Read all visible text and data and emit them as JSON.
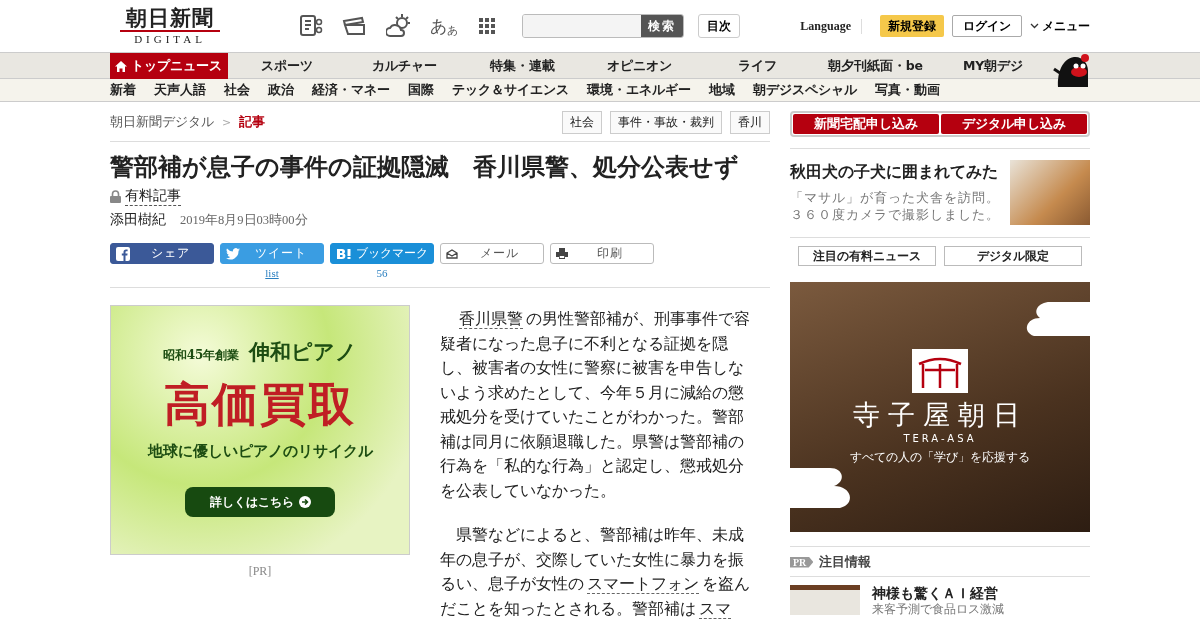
{
  "header": {
    "logo": {
      "name": "朝日新聞",
      "sub": "DIGITAL"
    },
    "tool_icons": [
      {
        "kind": "clipping"
      },
      {
        "kind": "ticket"
      },
      {
        "kind": "weather"
      },
      {
        "kind": "font",
        "large": "あ",
        "small": "あ"
      },
      {
        "kind": "grid"
      }
    ],
    "search": {
      "button": "検索"
    },
    "index_button": "目次",
    "language": "Language",
    "register": "新規登録",
    "login": "ログイン",
    "menu": "メニュー"
  },
  "nav_main": [
    {
      "label": "トップニュース",
      "selected": true
    },
    {
      "label": "スポーツ",
      "selected": false
    },
    {
      "label": "カルチャー",
      "selected": false
    },
    {
      "label": "特集・連載",
      "selected": false
    },
    {
      "label": "オピニオン",
      "selected": false
    },
    {
      "label": "ライフ",
      "selected": false
    },
    {
      "label": "朝夕刊紙面・be",
      "selected": false
    },
    {
      "label": "MY朝デジ",
      "selected": false
    }
  ],
  "nav_sub": [
    "新着",
    "天声人語",
    "社会",
    "政治",
    "経済・マネー",
    "国際",
    "テック＆サイエンス",
    "環境・エネルギー",
    "地域",
    "朝デジスペシャル",
    "写真・動画"
  ],
  "breadcrumb_separator": ">",
  "breadcrumb": [
    {
      "label": "朝日新聞デジタル",
      "current": false
    },
    {
      "label": "記事",
      "current": true
    }
  ],
  "tags": [
    "社会",
    "事件・事故・裁判",
    "香川"
  ],
  "article": {
    "title": "警部補が息子の事件の証拠隠滅　香川県警、処分公表せず",
    "paid_label": "有料記事",
    "author": "添田樹紀",
    "date": "2019年8月9日03時00分",
    "share": [
      {
        "kind": "facebook",
        "label": "シェア"
      },
      {
        "kind": "twitter",
        "label": "ツイート",
        "count": "list"
      },
      {
        "kind": "hatena",
        "label": "ブックマーク",
        "count": "56"
      },
      {
        "kind": "mail",
        "label": "メール"
      },
      {
        "kind": "print",
        "label": "印刷"
      }
    ],
    "paragraphs": [
      [
        {
          "text": "香川県警",
          "link": true
        },
        {
          "text": "の男性警部補が、刑事事件で容疑者になった息子に不利となる証拠を隠し、被害者の女性に警察に被害を申告しないよう求めたとして、今年５月に減給の懲戒処分を受けていたことがわかった。警部補は同月に依願退職した。県警は警部補の行為を「私的な行為」と認定し、懲戒処分を公表していなかった。",
          "link": false
        }
      ],
      [
        {
          "text": "県警などによると、警部補は昨年、未成年の息子が、交際していた女性に暴力を振るい、息子が女性の",
          "link": false
        },
        {
          "text": "スマートフォン",
          "link": true
        },
        {
          "text": "を盗んだことを知ったとされる。警部補は",
          "link": false
        },
        {
          "text": "スマ",
          "link": true
        }
      ]
    ]
  },
  "ad_left": {
    "tagline": "昭和45年創業",
    "brand": "伸和ピアノ",
    "headline": "高価買取",
    "sub": "地球に優しいピアノのリサイクル",
    "button": "詳しくはこちら",
    "pr": "[PR]"
  },
  "sidebar": {
    "subscribe": [
      "新聞宅配申し込み",
      "デジタル申し込み"
    ],
    "feature": {
      "title": "秋田犬の子犬に囲まれてみた",
      "desc": "「マサル」が育った犬舎を訪問。３６０度カメラで撮影しました。"
    },
    "tabs": [
      "注目の有料ニュース",
      "デジタル限定"
    ],
    "ad": {
      "title": "寺子屋朝日",
      "sub": "TERA-ASA",
      "tagline": "すべての人の「学び」を応援する"
    },
    "pr_section": {
      "badge": "PR",
      "title": "注目情報",
      "items": [
        {
          "title": "神様も驚くＡＩ経営",
          "desc": "来客予測で食品ロス激減"
        }
      ]
    }
  }
}
